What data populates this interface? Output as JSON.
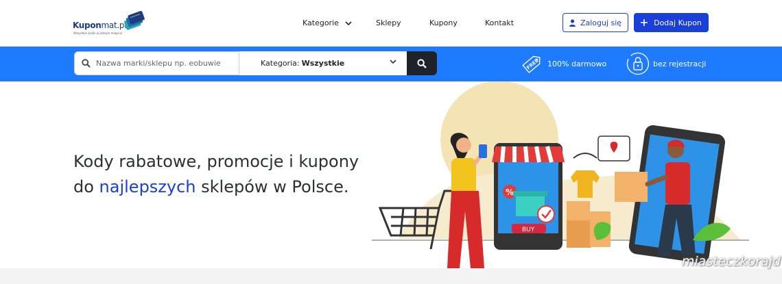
{
  "header": {
    "logo_prefix": "Kupon",
    "logo_suffix": "mat.pl",
    "logo_tagline": "Wszystkie zniżki w jednym miejscu!",
    "nav": {
      "categories": "Kategorie",
      "shops": "Sklepy",
      "coupons": "Kupony",
      "contact": "Kontakt"
    },
    "login_label": "Zaloguj się",
    "add_coupon_label": "Dodaj Kupon"
  },
  "search": {
    "placeholder": "Nazwa marki/sklepu np. eobuwie",
    "category_prefix": "Kategoria:",
    "category_value": "Wszystkie"
  },
  "features": {
    "free_badge": "FREE",
    "free_label": "100% darmowo",
    "no_register_label": "bez rejestracji"
  },
  "hero": {
    "title_line1": "Kody rabatowe, promocje i kupony",
    "title_line2_pre": "do ",
    "title_line2_accent": "najlepszych",
    "title_line2_post": " sklepów w Polsce.",
    "illustration_badge": "BUY",
    "illustration_percent": "%"
  },
  "watermark": "miasteczkorajd",
  "colors": {
    "primary_blue": "#1a3fd9",
    "search_bar": "#1e7bff",
    "search_button": "#1f2228"
  },
  "icons": {
    "chevron": "chevron-down-icon",
    "user": "user-icon",
    "plus": "plus-icon",
    "search": "search-icon",
    "free_tag": "free-tag-icon",
    "lock": "lock-icon"
  }
}
